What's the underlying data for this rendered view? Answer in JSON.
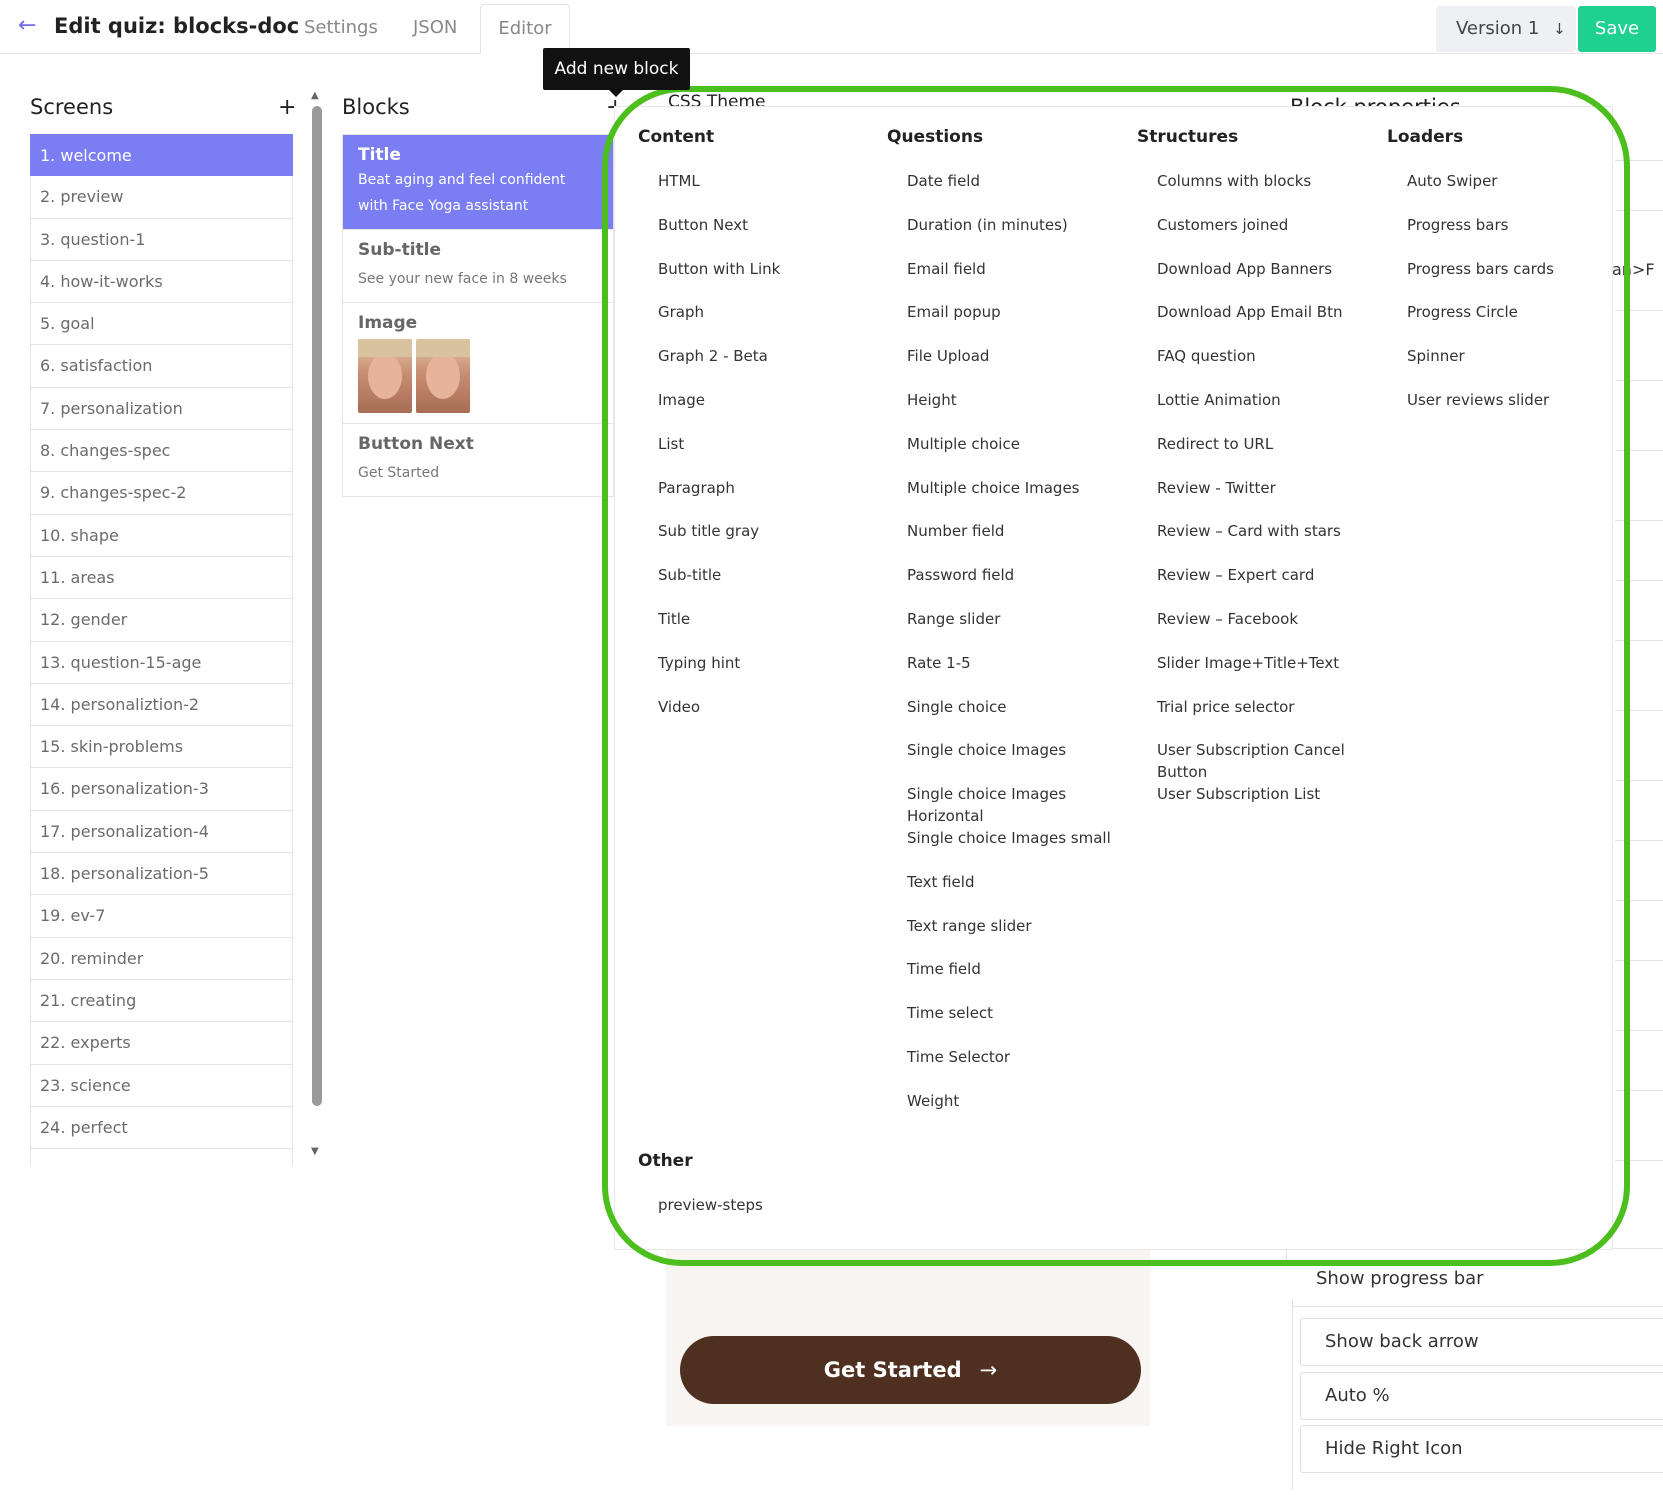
{
  "header": {
    "back_icon": "arrow-left-icon",
    "title": "Edit quiz: blocks-doc",
    "tabs": [
      "Settings",
      "JSON",
      "Editor"
    ],
    "version_label": "Version 1",
    "version_icon": "arrow-down-icon",
    "save_label": "Save",
    "accent": "#6e6ef0",
    "save_color": "#1fd190"
  },
  "tooltip": "Add new block",
  "screens": {
    "title": "Screens",
    "add": "+",
    "items": [
      "1. welcome",
      "2. preview",
      "3. question-1",
      "4. how-it-works",
      "5. goal",
      "6. satisfaction",
      "7. personalization",
      "8. changes-spec",
      "9. changes-spec-2",
      "10. shape",
      "11. areas",
      "12. gender",
      "13. question-15-age",
      "14. personaliztion-2",
      "15. skin-problems",
      "16. personalization-3",
      "17. personalization-4",
      "18. personalization-5",
      "19. ev-7",
      "20. reminder",
      "21. creating",
      "22. experts",
      "23. science",
      "24. perfect"
    ],
    "active_color": "#7b7ef2"
  },
  "blocks": {
    "title": "Blocks",
    "add": "+",
    "items": [
      {
        "name": "Title",
        "desc": "Beat aging and feel confident with Face Yoga assistant"
      },
      {
        "name": "Sub-title",
        "desc": "See your new face in 8 weeks"
      },
      {
        "name": "Image",
        "desc": ""
      },
      {
        "name": "Button Next",
        "desc": "Get Started"
      }
    ]
  },
  "panel": {
    "css_theme": "CSS Theme",
    "columns": [
      {
        "title": "Content",
        "items": [
          "HTML",
          "Button Next",
          "Button with Link",
          "Graph",
          "Graph 2 - Beta",
          "Image",
          "List",
          "Paragraph",
          "Sub title gray",
          "Sub-title",
          "Title",
          "Typing hint",
          "Video"
        ]
      },
      {
        "title": "Questions",
        "items": [
          "Date field",
          "Duration (in minutes)",
          "Email field",
          "Email popup",
          "File Upload",
          "Height",
          "Multiple choice",
          "Multiple choice Images",
          "Number field",
          "Password field",
          "Range slider",
          "Rate 1-5",
          "Single choice",
          "Single choice Images",
          "Single choice Images Horizontal",
          "Single choice Images small",
          "Text field",
          "Text range slider",
          "Time field",
          "Time select",
          "Time Selector",
          "Weight"
        ]
      },
      {
        "title": "Structures",
        "items": [
          "Columns with blocks",
          "Customers joined",
          "Download App Banners",
          "Download App Email Btn",
          "FAQ question",
          "Lottie Animation",
          "Redirect to URL",
          "Review - Twitter",
          "Review – Card with stars",
          "Review – Expert card",
          "Review – Facebook",
          "Slider Image+Title+Text",
          "Trial price selector",
          "User Subscription Cancel Button",
          "User Subscription List"
        ]
      },
      {
        "title": "Loaders",
        "items": [
          "Auto Swiper",
          "Progress bars",
          "Progress bars cards",
          "Progress Circle",
          "Spinner",
          "User reviews slider"
        ]
      }
    ],
    "other": {
      "title": "Other",
      "items": [
        "preview-steps"
      ]
    },
    "outline_color": "#4cbf1e"
  },
  "preview": {
    "button_label": "Get Started",
    "button_icon": "arrow-right-icon",
    "button_color": "#4f2f20"
  },
  "properties": {
    "title": "Block properties",
    "edge_text": "an>F",
    "options": [
      "Show progress bar",
      "Show back arrow",
      "Auto %",
      "Hide Right Icon"
    ]
  }
}
